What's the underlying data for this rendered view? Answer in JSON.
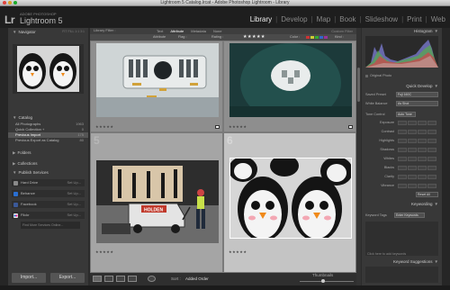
{
  "window": {
    "title": "Lightroom 5 Catalog.lrcat - Adobe Photoshop Lightroom - Library"
  },
  "identity": {
    "mark": "Lr",
    "subtitle": "ADOBE PHOTOSHOP",
    "product": "Lightroom 5"
  },
  "modules": [
    "Library",
    "Develop",
    "Map",
    "Book",
    "Slideshow",
    "Print",
    "Web"
  ],
  "active_module": "Library",
  "left_panel": {
    "navigator": {
      "label": "Navigator",
      "modes": "FIT  FILL  1:1  3:1"
    },
    "catalog": {
      "label": "Catalog",
      "items": [
        {
          "label": "All Photographs",
          "count": "1963"
        },
        {
          "label": "Quick Collection +",
          "count": "0"
        },
        {
          "label": "Previous Import",
          "count": "175"
        },
        {
          "label": "Previous Export as Catalog",
          "count": "80"
        }
      ],
      "selected_index": 2
    },
    "folders": {
      "label": "Folders"
    },
    "collections": {
      "label": "Collections"
    },
    "publish_services": {
      "label": "Publish Services",
      "items": [
        {
          "label": "Hard Drive",
          "action": "Set Up...",
          "color": "#8a8a8a"
        },
        {
          "label": "Behance",
          "action": "Set Up...",
          "color": "#2a6fd1"
        },
        {
          "label": "Facebook",
          "action": "Set Up...",
          "color": "#3b5998"
        },
        {
          "label": "Flickr",
          "action": "Set Up...",
          "color": "#e5e5e5"
        }
      ],
      "find_more": "Find More Services Online..."
    },
    "import_button": "Import...",
    "export_button": "Export..."
  },
  "filter_bar": {
    "title": "Library Filter :",
    "tabs": [
      "Text",
      "Attribute",
      "Metadata",
      "None"
    ],
    "active_tab": "Attribute",
    "preset": "Custom Filter",
    "attribute_label": "Attribute",
    "flag_label": "Flag :",
    "rating_label": "Rating :",
    "rating_stars": "★★★★★",
    "color_label": "Color :",
    "kind_label": "Kind :"
  },
  "grid": {
    "cells": [
      {
        "number": "",
        "rating": "★★★★★"
      },
      {
        "number": "",
        "rating": "★★★★★"
      },
      {
        "number": "5",
        "rating": "★★★★★"
      },
      {
        "number": "6",
        "rating": "★★★★★"
      }
    ]
  },
  "toolbar": {
    "sort_label": "Sort :",
    "sort_value": "Added Order",
    "thumbnails_label": "Thumbnails"
  },
  "right_panel": {
    "histogram": {
      "label": "Histogram",
      "original_photo": "Original Photo"
    },
    "quick_develop": {
      "label": "Quick Develop",
      "saved_preset_label": "Saved Preset",
      "saved_preset_value": "Fuji 160C",
      "white_balance_label": "White Balance",
      "white_balance_value": "As Shot",
      "tone_control_label": "Tone Control",
      "auto_tone": "Auto Tone",
      "sliders": [
        "Exposure",
        "Contrast",
        "Highlights",
        "Shadows",
        "Whites",
        "Blacks",
        "Clarity",
        "Vibrance"
      ],
      "reset_all": "Reset All"
    },
    "keywording": {
      "label": "Keywording",
      "keyword_tags_label": "Keyword Tags",
      "keyword_tags_value": "Enter Keywords",
      "add_hint": "Click here to add keywords"
    },
    "keyword_suggestions": {
      "label": "Keyword Suggestions"
    }
  },
  "colors": {
    "background": "#2b2b2b",
    "panel": "#383838",
    "grid": "#a8a8a8",
    "active_text": "#eeeeee"
  }
}
